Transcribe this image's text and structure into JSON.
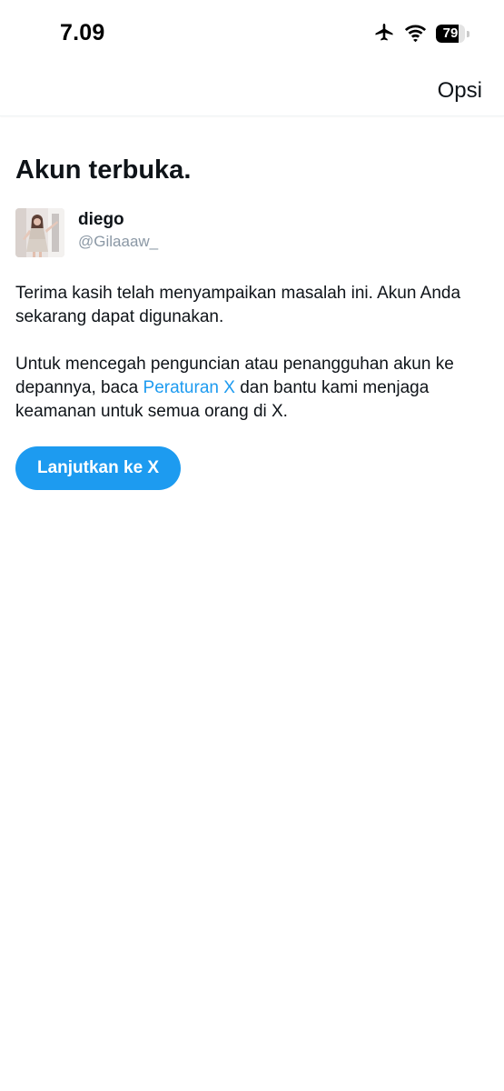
{
  "status_bar": {
    "time": "7.09",
    "battery_level": "79",
    "icons": [
      "airplane-icon",
      "wifi-icon",
      "battery-icon"
    ]
  },
  "nav": {
    "options_label": "Opsi"
  },
  "main": {
    "title": "Akun terbuka.",
    "account": {
      "display_name": "diego",
      "username": "@Gilaaaw_"
    },
    "paragraph1": "Terima kasih telah menyampaikan masalah ini. Akun Anda sekarang dapat digunakan.",
    "paragraph2_before": "Untuk mencegah penguncian atau penangguhan akun ke depannya, baca ",
    "paragraph2_link": "Peraturan X",
    "paragraph2_after": " dan bantu kami menjaga keamanan untuk semua orang di X.",
    "continue_label": "Lanjutkan ke X"
  },
  "colors": {
    "accent": "#1d9bf0",
    "text": "#0f1419",
    "secondary_text": "#8b98a5"
  }
}
